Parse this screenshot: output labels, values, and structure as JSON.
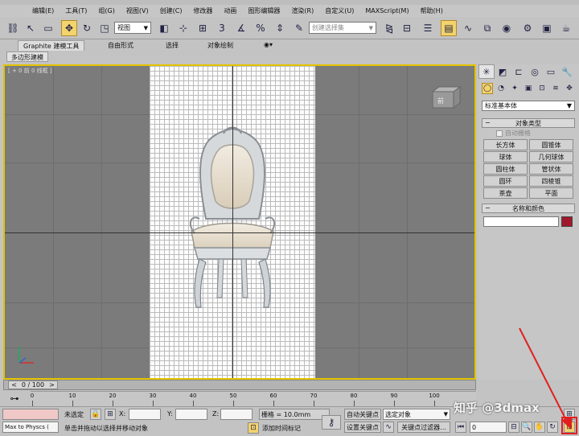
{
  "menubar": {
    "items": [
      "编辑(E)",
      "工具(T)",
      "组(G)",
      "视图(V)",
      "创建(C)",
      "修改器",
      "动画",
      "图形编辑器",
      "渲染(R)",
      "自定义(U)",
      "MAXScript(M)",
      "帮助(H)"
    ]
  },
  "toolbar": {
    "view_dropdown": "视图",
    "selection_set_placeholder": "创建选择集"
  },
  "ribbon": {
    "tabs": [
      "Graphite 建模工具",
      "自由形式",
      "选择",
      "对象绘制"
    ],
    "subtab": "多边形建模"
  },
  "viewport": {
    "label": "[ + 0 前 0 线框 ]",
    "viewcube_label": "前"
  },
  "command_panel": {
    "category": "标准基本体",
    "object_type_title": "对象类型",
    "autogrid_label": "自动栅格",
    "object_buttons": [
      "长方体",
      "圆锥体",
      "球体",
      "几何球体",
      "圆柱体",
      "管状体",
      "圆环",
      "四棱锥",
      "茶壶",
      "平面"
    ],
    "name_color_title": "名称和颜色",
    "swatch_color": "#a0182c"
  },
  "timeline": {
    "position": "0 / 100",
    "ticks": [
      "0",
      "10",
      "20",
      "30",
      "40",
      "50",
      "60",
      "70",
      "80",
      "90",
      "100"
    ]
  },
  "status": {
    "script_listener": "Max to Physcs (",
    "selection": "未选定",
    "x_label": "X:",
    "y_label": "Y:",
    "z_label": "Z:",
    "prompt": "单击并拖动以选择并移动对象",
    "grid": "栅格 = 10.0mm",
    "add_time_tag": "添加时间标记",
    "auto_key": "自动关键点",
    "set_key": "设置关键点",
    "selected_object": "选定对象",
    "key_filters": "关键点过滤器...",
    "frame": "0"
  },
  "watermark": "知乎 @3dmax",
  "colors": {
    "viewport_border": "#e3c400",
    "active_button": "#f3d36c",
    "annotation_red": "#e02020"
  }
}
